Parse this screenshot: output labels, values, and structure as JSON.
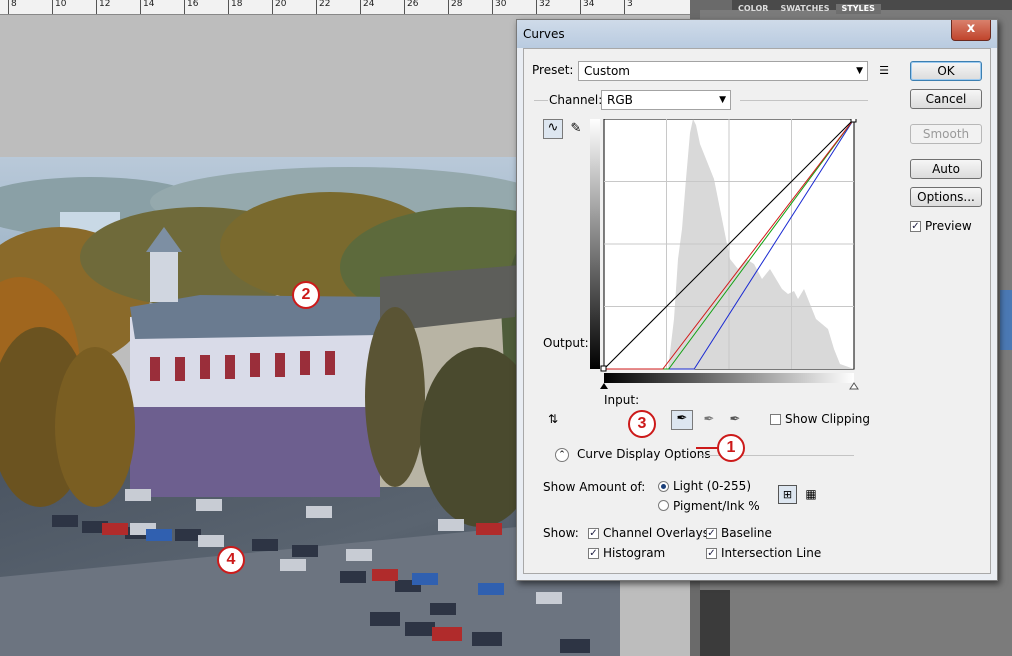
{
  "ruler": {
    "ticks": [
      "8",
      "10",
      "12",
      "14",
      "16",
      "18",
      "20",
      "22",
      "24",
      "26",
      "28",
      "30",
      "32",
      "34",
      "3"
    ]
  },
  "panel_tabs": {
    "color": "COLOR",
    "swatches": "SWATCHES",
    "styles": "STYLES"
  },
  "dialog": {
    "title": "Curves",
    "close_label": "x",
    "preset_label": "Preset:",
    "preset_value": "Custom",
    "channel_label": "Channel:",
    "channel_value": "RGB",
    "output_label": "Output:",
    "input_label": "Input:",
    "show_clipping_label": "Show Clipping",
    "curve_display_options_label": "Curve Display Options",
    "show_amount_label": "Show Amount of:",
    "light_label": "Light  (0-255)",
    "pigment_label": "Pigment/Ink %",
    "show_label": "Show:",
    "channel_overlays_label": "Channel Overlays",
    "baseline_label": "Baseline",
    "histogram_label": "Histogram",
    "intersection_line_label": "Intersection Line",
    "buttons": {
      "ok": "OK",
      "cancel": "Cancel",
      "smooth": "Smooth",
      "auto": "Auto",
      "options": "Options..."
    },
    "preview_label": "Preview",
    "checks": {
      "show_clipping": false,
      "channel_overlays": true,
      "baseline": true,
      "histogram": true,
      "intersection_line": true,
      "preview": true
    },
    "amount_selected": "light"
  },
  "annotations": {
    "m1": "1",
    "m2": "2",
    "m3": "3",
    "m4": "4"
  },
  "curves": {
    "composite": [
      [
        0,
        0
      ],
      [
        255,
        255
      ]
    ],
    "red": [
      [
        0,
        0
      ],
      [
        60,
        0
      ],
      [
        255,
        255
      ]
    ],
    "green": [
      [
        0,
        0
      ],
      [
        66,
        0
      ],
      [
        255,
        255
      ]
    ],
    "blue": [
      [
        0,
        0
      ],
      [
        92,
        0
      ],
      [
        255,
        255
      ]
    ]
  },
  "colors": {
    "red_curve": "#d21a1a",
    "green_curve": "#14a214",
    "blue_curve": "#1a2ad2",
    "marker": "#cc1a1a"
  }
}
